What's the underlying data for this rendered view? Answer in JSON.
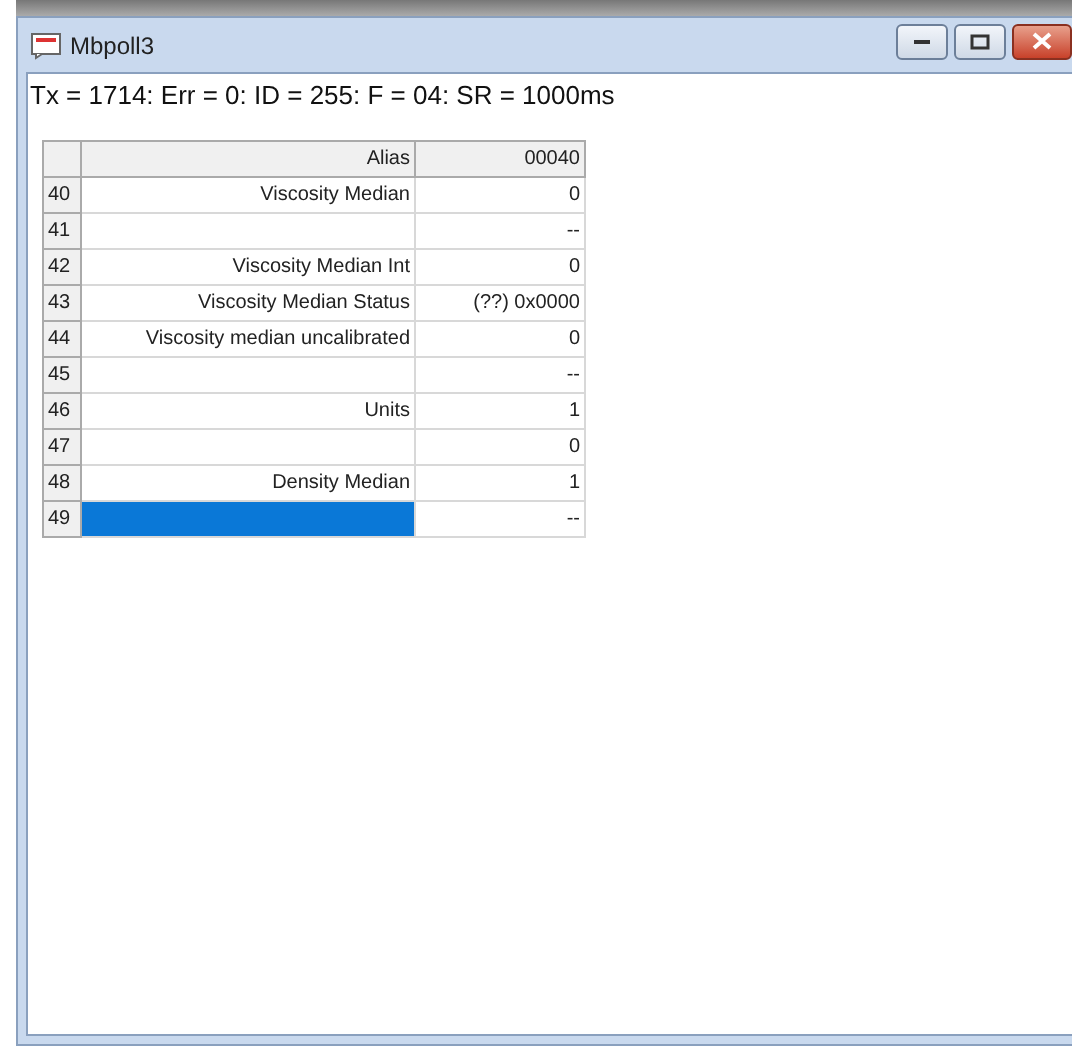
{
  "window": {
    "title": "Mbpoll3"
  },
  "status_line": "Tx = 1714: Err = 0: ID = 255: F = 04: SR = 1000ms",
  "table": {
    "columns": [
      "Alias",
      "00040"
    ],
    "rows": [
      {
        "number": "40",
        "alias": "Viscosity Median",
        "value": "0",
        "selected": false
      },
      {
        "number": "41",
        "alias": "",
        "value": "--",
        "selected": false
      },
      {
        "number": "42",
        "alias": "Viscosity Median Int",
        "value": "0",
        "selected": false
      },
      {
        "number": "43",
        "alias": "Viscosity Median Status",
        "value": "(??) 0x0000",
        "selected": false
      },
      {
        "number": "44",
        "alias": "Viscosity median uncalibrated",
        "value": "0",
        "selected": false
      },
      {
        "number": "45",
        "alias": "",
        "value": "--",
        "selected": false
      },
      {
        "number": "46",
        "alias": "Units",
        "value": "1",
        "selected": false
      },
      {
        "number": "47",
        "alias": "",
        "value": "0",
        "selected": false
      },
      {
        "number": "48",
        "alias": "Density Median",
        "value": "1",
        "selected": false
      },
      {
        "number": "49",
        "alias": "",
        "value": "--",
        "selected": true
      }
    ]
  }
}
